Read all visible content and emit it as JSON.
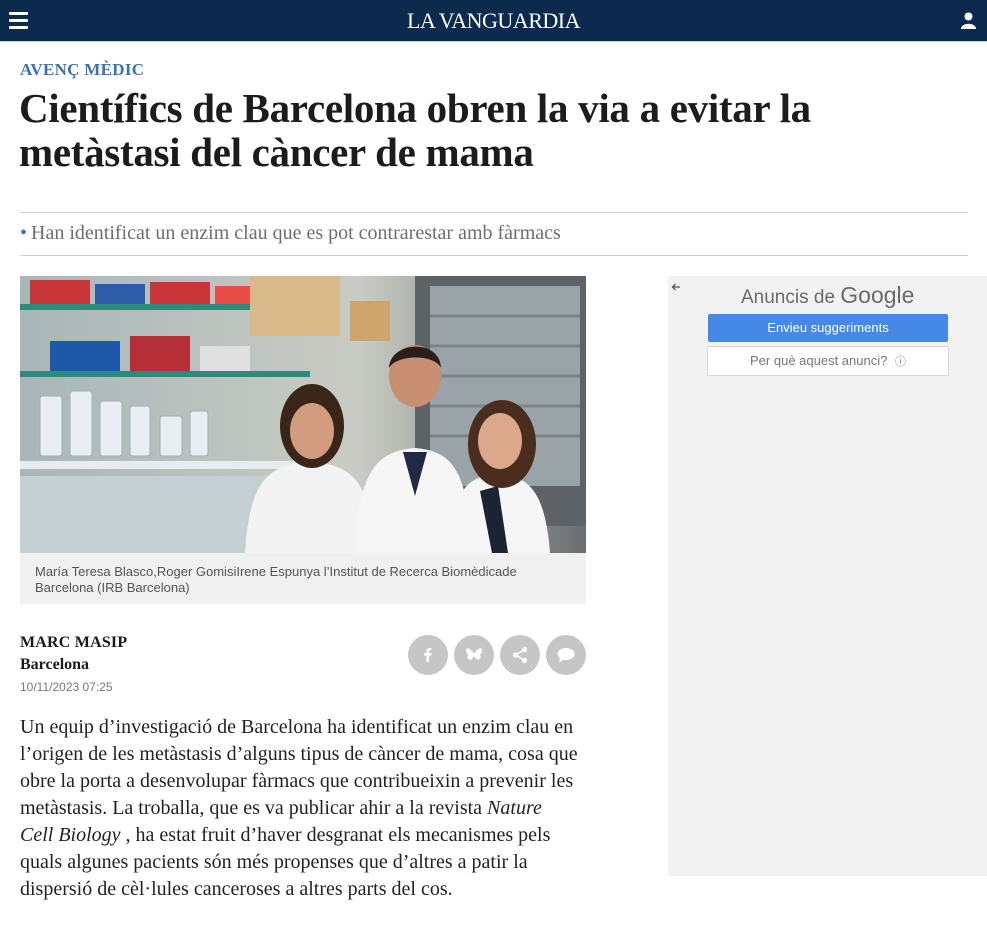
{
  "header": {
    "logo_text": "LA VANGUARDIA",
    "menu_icon": "hamburger-menu-icon",
    "user_icon": "user-icon",
    "background_color": "#0c2a4e"
  },
  "article": {
    "section": "AVENÇ MÈDIC",
    "headline": "Científics de Barcelona obren la via a evitar la metàstasi del càncer de mama",
    "subtitle": "Han identificat un enzim clau que es pot contrarestar amb fàrmacs",
    "photo_caption": "María Teresa Blasco,Roger GomisiIrene Espunya l’Institut de Recerca Biomèdicade Barcelona (IRB Barcelona)",
    "author": "MARC MASIP",
    "location": "Barcelona",
    "date": "10/11/2023 07:25",
    "body_before_italic": "Un equip d’investigació de Barcelona ha identificat un enzim clau en l’origen de les metàstasis d’alguns tipus de càncer de mama, cosa que obre la porta a desenvolupar fàrmacs que contribueixin a prevenir les metàstasis. La troballa, que es va publicar ahir a la revista ",
    "body_italic": "Nature Cell Biology",
    "body_after_italic": " , ha estat fruit d’haver desgranat els mecanismes pels quals algunes pacients són més propenses que d’altres a patir la dispersió de cèl·lules canceroses a altres parts del cos.",
    "share_buttons": [
      "facebook-icon",
      "bluesky-icon",
      "share-icon",
      "comment-icon"
    ],
    "accent_color": "#3d73ad"
  },
  "ad": {
    "title_prefix": "Anuncis de",
    "title_brand": "Google",
    "primary_button": "Envieu suggeriments",
    "secondary_button": "Per què aquest anunci?",
    "info_icon": "ⓘ"
  }
}
